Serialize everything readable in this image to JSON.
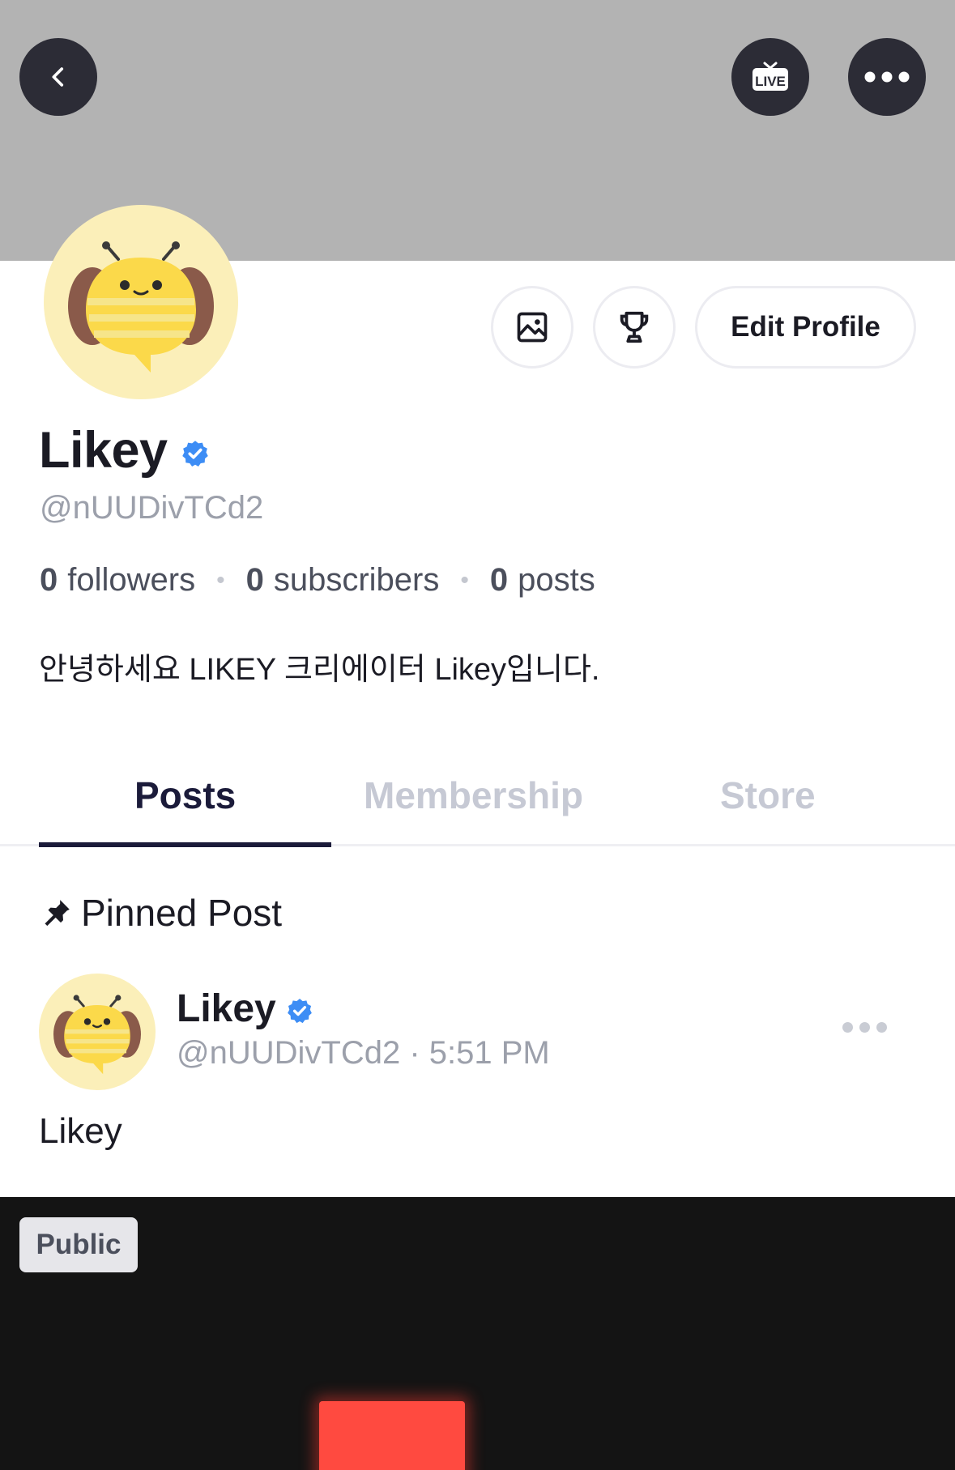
{
  "header": {
    "back_icon": "chevron-left-icon",
    "live_label": "LIVE",
    "more_icon": "ellipsis-icon"
  },
  "profile": {
    "name": "Likey",
    "handle": "@nUUDivTCd2",
    "verified_color": "#3d8df5",
    "edit_profile_label": "Edit Profile",
    "stats": {
      "followers_count": "0",
      "followers_label": "followers",
      "subscribers_count": "0",
      "subscribers_label": "subscribers",
      "posts_count": "0",
      "posts_label": "posts"
    },
    "bio": "안녕하세요 LIKEY 크리에이터 Likey입니다."
  },
  "tabs": [
    {
      "label": "Posts",
      "active": true
    },
    {
      "label": "Membership",
      "active": false
    },
    {
      "label": "Store",
      "active": false
    }
  ],
  "pinned": {
    "label": "Pinned Post"
  },
  "post": {
    "author": "Likey",
    "meta": "@nUUDivTCd2 · 5:51 PM",
    "text": "Likey",
    "badge": "Public"
  }
}
